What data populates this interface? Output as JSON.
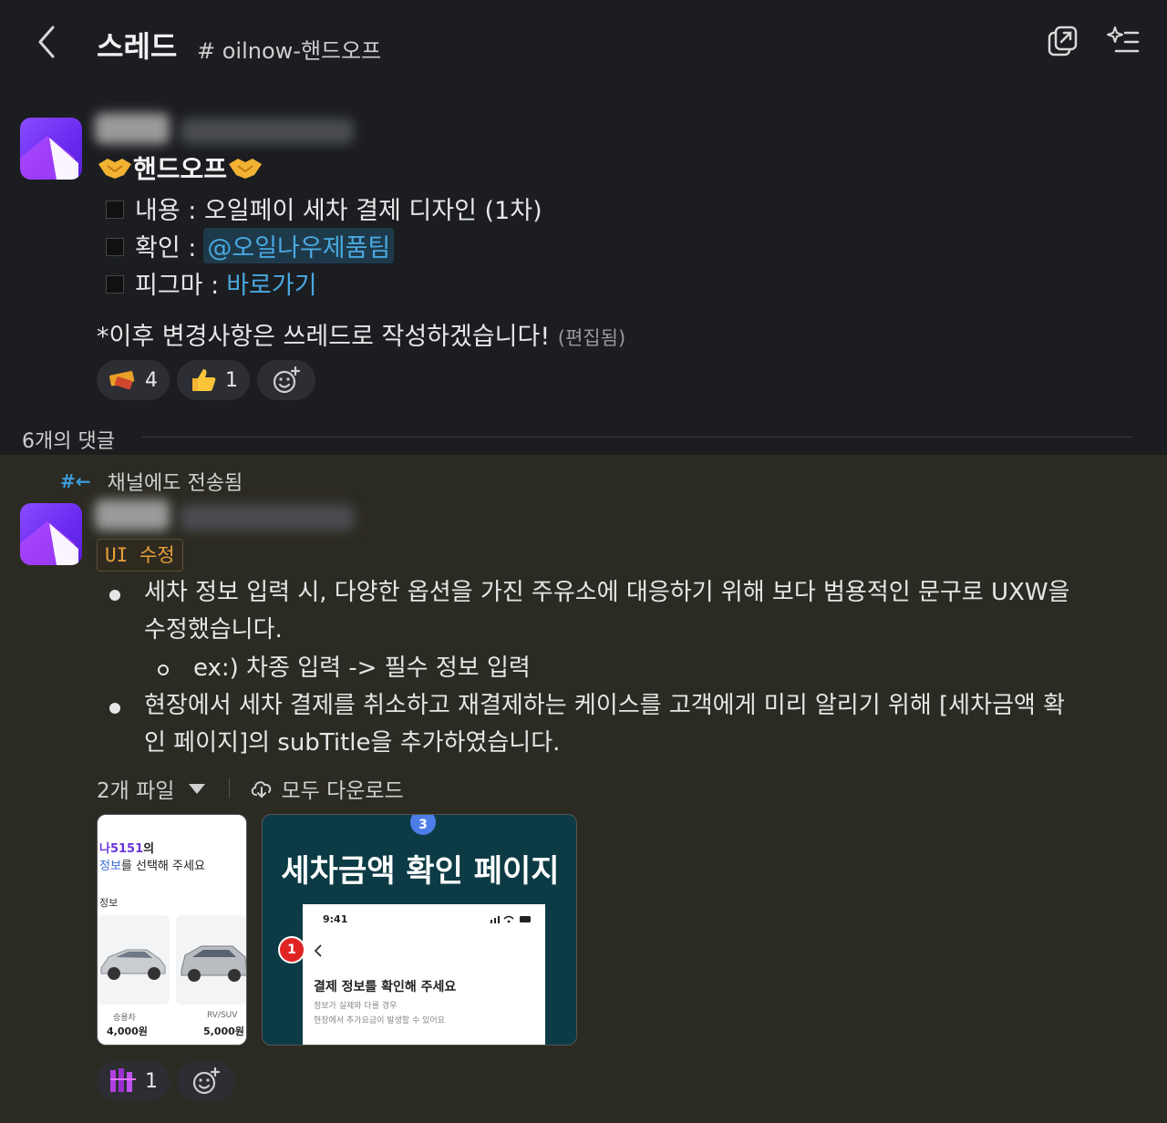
{
  "header": {
    "title": "스레드",
    "channel": "# oilnow-핸드오프",
    "back_icon": "chevron-left-icon",
    "open_window_icon": "external-window-icon",
    "ai_summary_icon": "sparkle-list-icon"
  },
  "message1": {
    "heading": "핸드오프",
    "content_line": "내용 : 오일페이 세차 결제 디자인 (1차)",
    "confirm_label": "확인 :",
    "confirm_mention": "@오일나우제품팀",
    "figma_label": "피그마 :",
    "figma_link": "바로가기",
    "note": "*이후 변경사항은 쓰레드로 작성하겠습니다!",
    "edited": "(편집됨)",
    "reactions": [
      {
        "icon": "tape-icon",
        "count": "4"
      },
      {
        "icon": "thumbs-up-icon",
        "count": "1"
      }
    ]
  },
  "replies": {
    "count_label": "6개의 댓글"
  },
  "message2": {
    "sent_to_channel": "채널에도 전송됨",
    "code_label": "UI  수정",
    "bullet1_line1": "세차 정보 입력 시, 다양한 옵션을 가진 주유소에 대응하기 위해 보다 범용적인 문구로 UXW을",
    "bullet1_line2": "수정했습니다.",
    "sub_bullet": "ex:) 차종 입력 -> 필수 정보 입력",
    "bullet2_line1": "현장에서 세차 결제를 취소하고 재결제하는 케이스를 고객에게 미리 알리기 위해 [세차금액 확",
    "bullet2_line2": "인 페이지]의 subTitle을 추가하였습니다.",
    "files_label": "2개 파일",
    "download_all": "모두 다운로드",
    "thumb1": {
      "plate": "나5151",
      "plate_suffix": "의",
      "select_line_prefix": "정보",
      "select_line_rest": "를 선택해 주세요",
      "info_label": "정보",
      "car1_type": "승용차",
      "car1_price": "4,000원",
      "car2_type": "RV/SUV",
      "car2_price": "5,000원"
    },
    "thumb2": {
      "badge": "3",
      "title": "세차금액 확인 페이지",
      "time": "9:41",
      "marker": "1",
      "screen_title": "결제 정보를 확인해 주세요",
      "sub1": "정보가 실제와 다를 경우",
      "sub2": "현장에서 추가요금이 발생할 수 있어요"
    },
    "reactions": [
      {
        "icon": "custom-emoji-icon",
        "count": "1"
      }
    ]
  },
  "colors": {
    "background": "#1b1d21",
    "highlight_bg": "#2c2b23",
    "link": "#4aa8e0",
    "code_text": "#e8a03a",
    "avatar": "#7a3cf5"
  }
}
